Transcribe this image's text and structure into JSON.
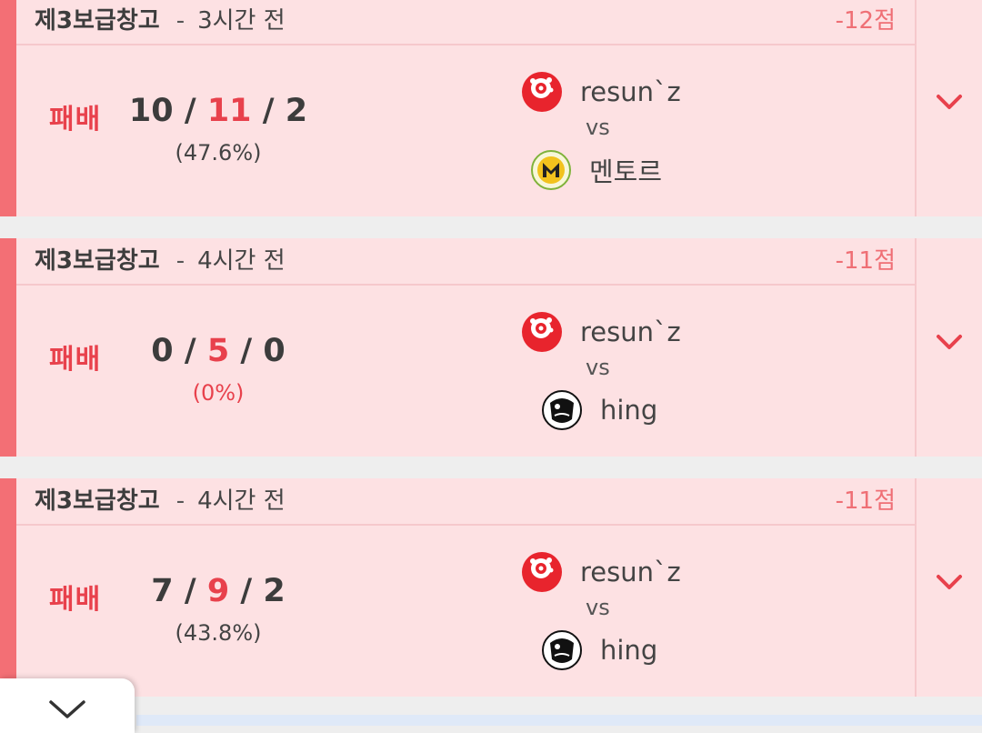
{
  "matches": [
    {
      "map": "제3보급창고",
      "separator": "-",
      "time_ago": "3시간 전",
      "score_change": "-12점",
      "result": "패배",
      "kda": {
        "kills": "10",
        "deaths": "11",
        "assists": "2"
      },
      "slash": "/",
      "ratio": "(47.6%)",
      "team_a": {
        "name": "resun`z",
        "logo": "red-emblem-icon"
      },
      "vs": "vs",
      "team_b": {
        "name": "멘토르",
        "logo": "mentor-m-emblem-icon"
      }
    },
    {
      "map": "제3보급창고",
      "separator": "-",
      "time_ago": "4시간 전",
      "score_change": "-11점",
      "result": "패배",
      "kda": {
        "kills": "0",
        "deaths": "5",
        "assists": "0"
      },
      "slash": "/",
      "ratio": "(0%)",
      "team_a": {
        "name": "resun`z",
        "logo": "red-emblem-icon"
      },
      "vs": "vs",
      "team_b": {
        "name": "hing",
        "logo": "black-bird-emblem-icon"
      }
    },
    {
      "map": "제3보급창고",
      "separator": "-",
      "time_ago": "4시간 전",
      "score_change": "-11점",
      "result": "패배",
      "kda": {
        "kills": "7",
        "deaths": "9",
        "assists": "2"
      },
      "slash": "/",
      "ratio": "(43.8%)",
      "team_a": {
        "name": "resun`z",
        "logo": "red-emblem-icon"
      },
      "vs": "vs",
      "team_b": {
        "name": "hing",
        "logo": "black-bird-emblem-icon"
      }
    }
  ],
  "colors": {
    "card_bg": "#fde1e3",
    "loss_strip": "#f36f75",
    "loss_text": "#e8414c",
    "score_text": "#ef6f75"
  }
}
